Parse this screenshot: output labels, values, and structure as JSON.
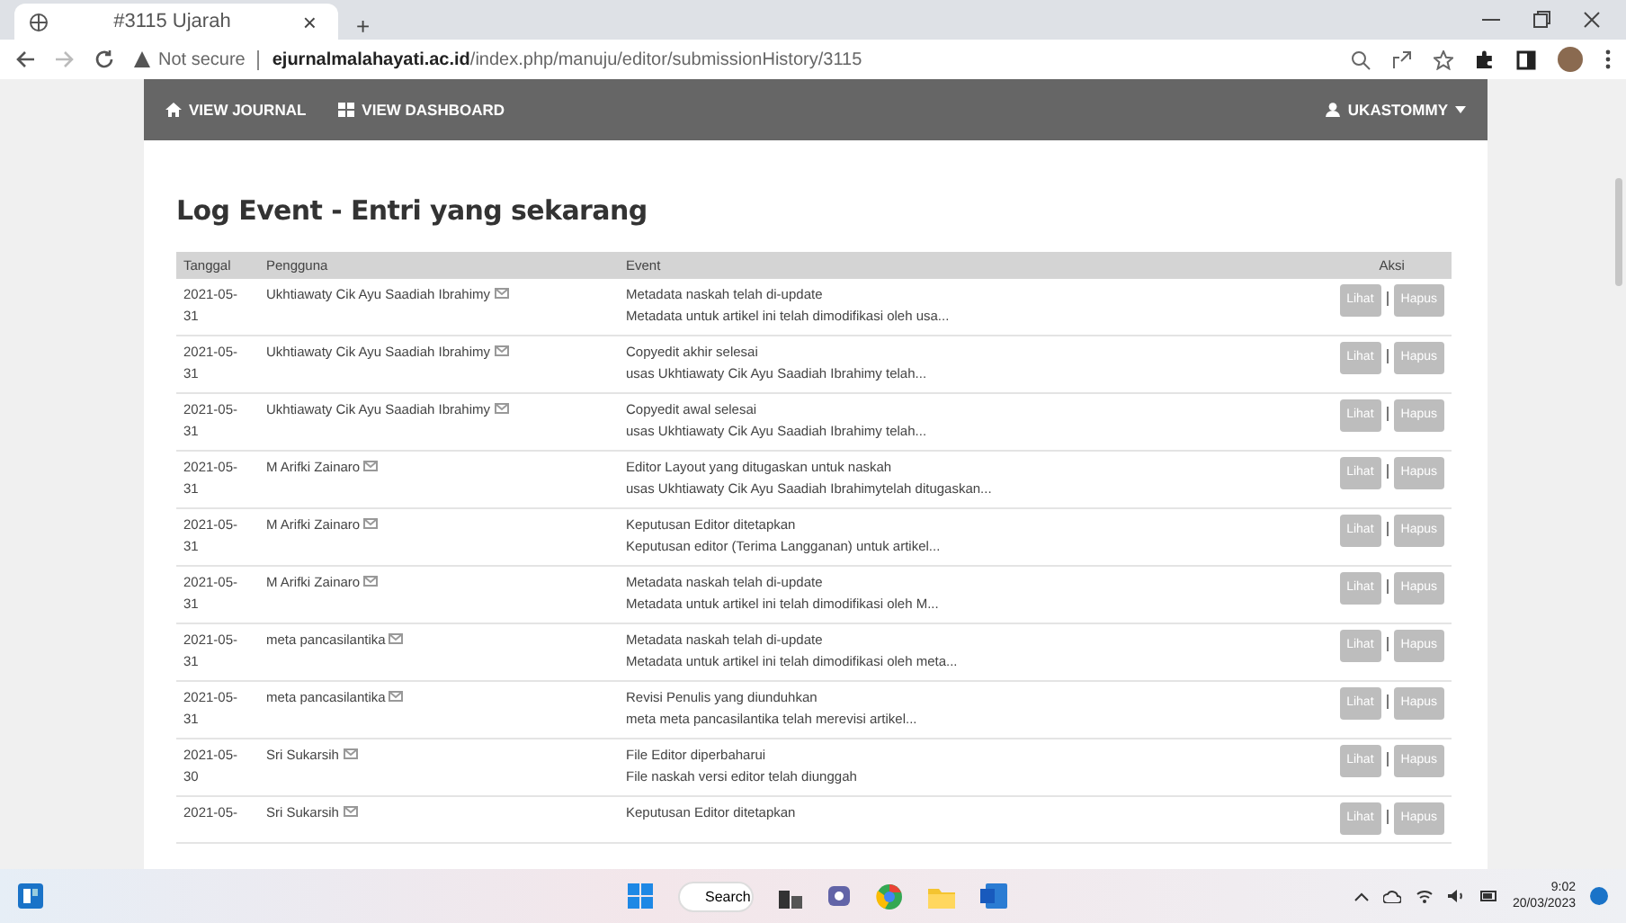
{
  "browser": {
    "tab_title": "#3115 Ujarah",
    "tab_close": "×",
    "new_tab": "+",
    "security": "Not secure",
    "url_host": "ejurnalmalahayati.ac.id",
    "url_path": "/index.php/manuju/editor/submissionHistory/3115"
  },
  "nav": {
    "items": [
      {
        "label": "VIEW JOURNAL",
        "kind": "home"
      },
      {
        "label": "VIEW DASHBOARD",
        "kind": "dashboard"
      }
    ],
    "user": "UKASTOMMY"
  },
  "page": {
    "title": "Log Event - Entri yang sekarang"
  },
  "table": {
    "columns": [
      "Tanggal",
      "Pengguna",
      "Event",
      "Aksi"
    ],
    "rows": [
      {
        "date": "2021-05-31",
        "user": "Ukhtiawaty Cik Ayu Saadiah Ibrahimy",
        "event": "Metadata naskah telah di-update",
        "detail": "Metadata untuk artikel ini telah dimodifikasi oleh usa...",
        "actions": [
          "Lihat",
          "Hapus"
        ]
      },
      {
        "date": "2021-05-31",
        "user": "Ukhtiawaty Cik Ayu Saadiah Ibrahimy",
        "event": "Copyedit akhir selesai",
        "detail": "usas Ukhtiawaty Cik Ayu Saadiah Ibrahimy telah...",
        "actions": [
          "Lihat",
          "Hapus"
        ]
      },
      {
        "date": "2021-05-31",
        "user": "Ukhtiawaty Cik Ayu Saadiah Ibrahimy",
        "event": "Copyedit awal selesai",
        "detail": "usas Ukhtiawaty Cik Ayu Saadiah Ibrahimy telah...",
        "actions": [
          "Lihat",
          "Hapus"
        ]
      },
      {
        "date": "2021-05-31",
        "user": "M Arifki Zainaro",
        "event": "Editor Layout yang ditugaskan untuk naskah",
        "detail": "usas Ukhtiawaty Cik Ayu Saadiah Ibrahimytelah ditugaskan...",
        "actions": [
          "Lihat",
          "Hapus"
        ]
      },
      {
        "date": "2021-05-31",
        "user": "M Arifki Zainaro",
        "event": "Keputusan Editor ditetapkan",
        "detail": "Keputusan editor (Terima Langganan) untuk artikel...",
        "actions": [
          "Lihat",
          "Hapus"
        ]
      },
      {
        "date": "2021-05-31",
        "user": "M Arifki Zainaro",
        "event": "Metadata naskah telah di-update",
        "detail": "Metadata untuk artikel ini telah dimodifikasi oleh M...",
        "actions": [
          "Lihat",
          "Hapus"
        ]
      },
      {
        "date": "2021-05-31",
        "user": "meta pancasilantika",
        "event": "Metadata naskah telah di-update",
        "detail": "Metadata untuk artikel ini telah dimodifikasi oleh meta...",
        "actions": [
          "Lihat",
          "Hapus"
        ]
      },
      {
        "date": "2021-05-31",
        "user": "meta pancasilantika",
        "event": "Revisi Penulis yang diunduhkan",
        "detail": "meta meta pancasilantika telah merevisi artikel...",
        "actions": [
          "Lihat",
          "Hapus"
        ]
      },
      {
        "date": "2021-05-30",
        "user": "Sri Sukarsih",
        "event": "File Editor diperbaharui",
        "detail": "File naskah versi editor telah diunggah",
        "actions": [
          "Lihat",
          "Hapus"
        ]
      },
      {
        "date": "2021-05-",
        "user": "Sri Sukarsih",
        "event": "Keputusan Editor ditetapkan",
        "actions": [
          "Lihat",
          "Hapus"
        ]
      }
    ]
  },
  "taskbar": {
    "search": "Search",
    "time": "9:02",
    "date": "20/03/2023"
  }
}
